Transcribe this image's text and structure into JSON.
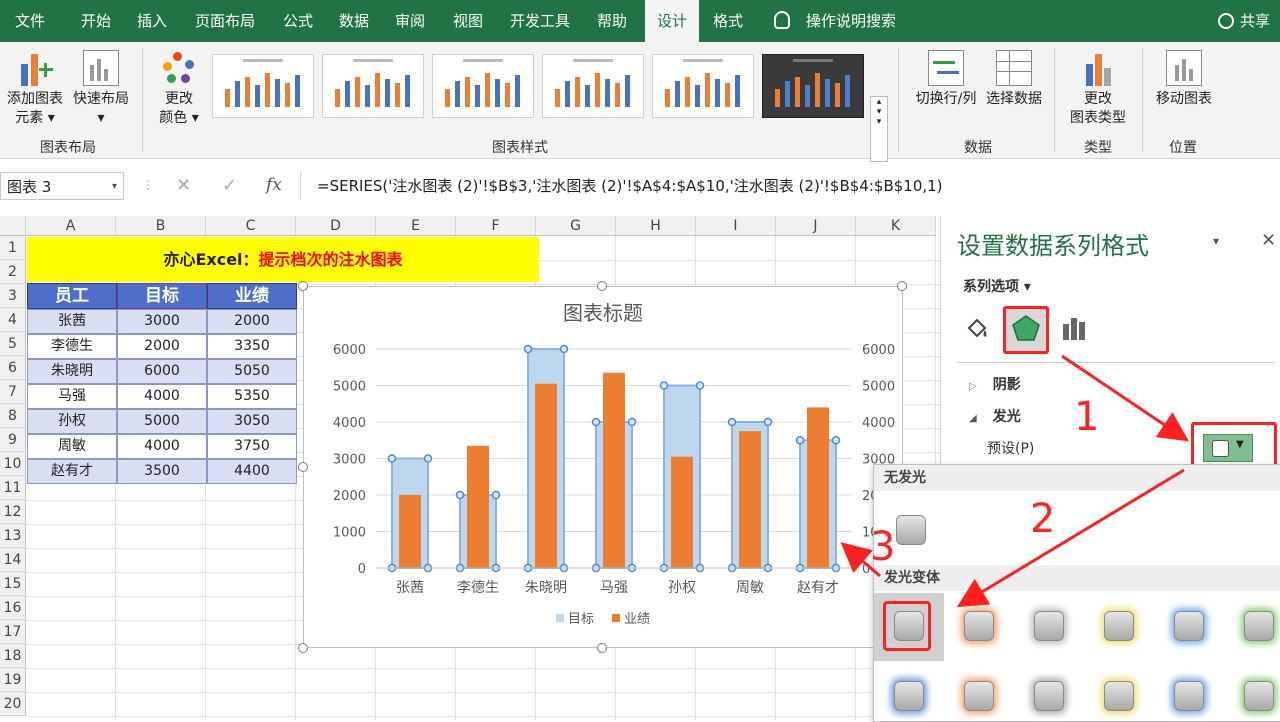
{
  "ribbon": {
    "tabs": [
      "文件",
      "开始",
      "插入",
      "页面布局",
      "公式",
      "数据",
      "审阅",
      "视图",
      "开发工具",
      "帮助",
      "设计",
      "格式"
    ],
    "active_tab": "设计",
    "search": "操作说明搜索",
    "share": "共享",
    "buttons": {
      "add_element_1": "添加图表",
      "add_element_2": "元素",
      "quick_layout": "快速布局",
      "change_color_1": "更改",
      "change_color_2": "颜色",
      "switch_row_col": "切换行/列",
      "select_data": "选择数据",
      "change_type_1": "更改",
      "change_type_2": "图表类型",
      "move_chart": "移动图表"
    },
    "groups": {
      "layout": "图表布局",
      "styles": "图表样式",
      "data": "数据",
      "type": "类型",
      "location": "位置"
    }
  },
  "formula_bar": {
    "name_box": "图表 3",
    "fx": "fx",
    "formula": "=SERIES('注水图表 (2)'!$B$3,'注水图表 (2)'!$A$4:$A$10,'注水图表 (2)'!$B$4:$B$10,1)"
  },
  "sheet": {
    "columns": [
      "A",
      "B",
      "C",
      "D",
      "E",
      "F",
      "G",
      "H",
      "I",
      "J",
      "K"
    ],
    "rows": [
      "1",
      "2",
      "3",
      "4",
      "5",
      "6",
      "7",
      "8",
      "9",
      "10",
      "11",
      "12",
      "13",
      "14",
      "15",
      "16",
      "17",
      "18",
      "19",
      "20"
    ],
    "title_black": "亦心Excel：",
    "title_red": "提示档次的注水图表",
    "headers": [
      "员工",
      "目标",
      "业绩"
    ],
    "data": [
      [
        "张茜",
        "3000",
        "2000"
      ],
      [
        "李德生",
        "2000",
        "3350"
      ],
      [
        "朱晓明",
        "6000",
        "5050"
      ],
      [
        "马强",
        "4000",
        "5350"
      ],
      [
        "孙权",
        "5000",
        "3050"
      ],
      [
        "周敏",
        "4000",
        "3750"
      ],
      [
        "赵有才",
        "3500",
        "4400"
      ]
    ]
  },
  "chart_data": {
    "type": "bar",
    "title": "图表标题",
    "categories": [
      "张茜",
      "李德生",
      "朱晓明",
      "马强",
      "孙权",
      "周敏",
      "赵有才"
    ],
    "series": [
      {
        "name": "目标",
        "values": [
          3000,
          2000,
          6000,
          4000,
          5000,
          4000,
          3500
        ],
        "color": "#bdd7ee",
        "axis": "secondary"
      },
      {
        "name": "业绩",
        "values": [
          2000,
          3350,
          5050,
          5350,
          3050,
          3750,
          4400
        ],
        "color": "#ed7d31",
        "axis": "primary"
      }
    ],
    "ylim": [
      0,
      6000
    ],
    "yticks": [
      "0",
      "1000",
      "2000",
      "3000",
      "4000",
      "5000",
      "6000"
    ],
    "y2ticks": [
      "0",
      "1000",
      "2000",
      "3000",
      "4000",
      "5000",
      "6000"
    ],
    "legend": "bottom",
    "grid": true
  },
  "pane": {
    "title": "设置数据系列格式",
    "series_options": "系列选项",
    "shadow": "阴影",
    "glow": "发光",
    "preset": "预设(P)"
  },
  "gallery": {
    "no_glow": "无发光",
    "variants": "发光变体",
    "row2_colors": [
      "#6f9be0",
      "#f4a470",
      "#b0b0b0",
      "#f0e070",
      "#7aa8e8",
      "#8fd07a"
    ],
    "row1_colors": [
      "#888888",
      "#f4a470",
      "#c0c0c0",
      "#f0e070",
      "#7ab0f0",
      "#8fd07a"
    ]
  },
  "callouts": [
    "1",
    "2",
    "3"
  ]
}
